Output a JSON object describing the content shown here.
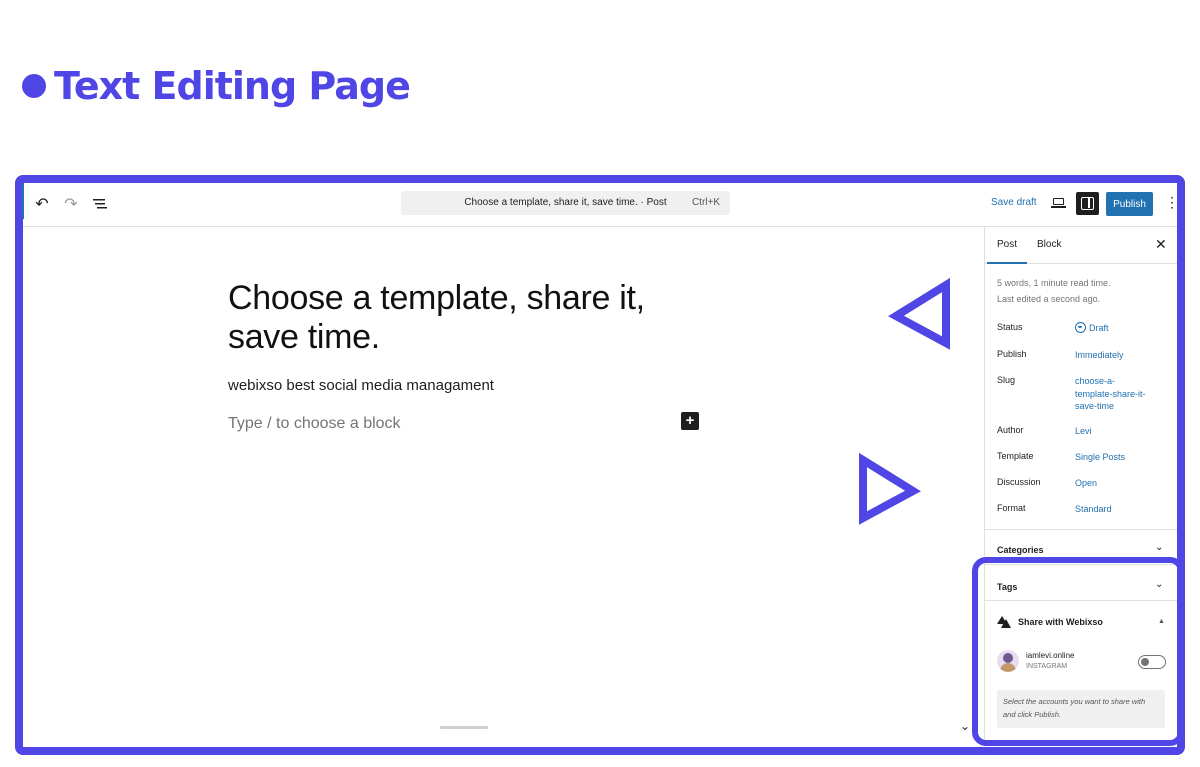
{
  "heading": {
    "title": "Text Editing Page"
  },
  "toolbar": {
    "command": {
      "title": "Choose a template, share it, save time. · Post",
      "shortcut": "Ctrl+K"
    },
    "save_draft": "Save draft",
    "publish": "Publish"
  },
  "editor": {
    "title_line1": "Choose a template, share it,",
    "title_line2": "save time.",
    "paragraph": "webixso best social media managament",
    "placeholder": "Type / to choose a block"
  },
  "sidebar": {
    "tabs": [
      "Post",
      "Block"
    ],
    "meta_line1": "5 words, 1 minute read time.",
    "meta_line2": "Last edited a second ago.",
    "rows": [
      {
        "label": "Status",
        "value": "Draft"
      },
      {
        "label": "Publish",
        "value": "Immediately"
      },
      {
        "label": "Slug",
        "value": "choose-a-template-share-it-save-time"
      },
      {
        "label": "Author",
        "value": "Levi"
      },
      {
        "label": "Template",
        "value": "Single Posts"
      },
      {
        "label": "Discussion",
        "value": "Open"
      },
      {
        "label": "Format",
        "value": "Standard"
      }
    ],
    "slug_lines": [
      "choose-a-",
      "template-share-it-",
      "save-time"
    ],
    "categories": "Categories",
    "tags": "Tags",
    "share": {
      "title": "Share with Webixso",
      "account_name": "iamlevi.online",
      "account_network": "INSTAGRAM",
      "notice": "Select the accounts you want to share with and click Publish."
    }
  },
  "colors": {
    "accent": "#4f46e5",
    "link": "#2271b1",
    "dark": "#1e1e1e"
  },
  "icons": {
    "undo": "undo-icon",
    "redo": "redo-icon",
    "list_view": "list-view-icon",
    "view": "desktop-view-icon",
    "settings": "sidebar-toggle-icon",
    "more": "more-vertical-icon",
    "close": "close-icon",
    "chevron": "chevron-down-icon",
    "add": "plus-icon"
  }
}
